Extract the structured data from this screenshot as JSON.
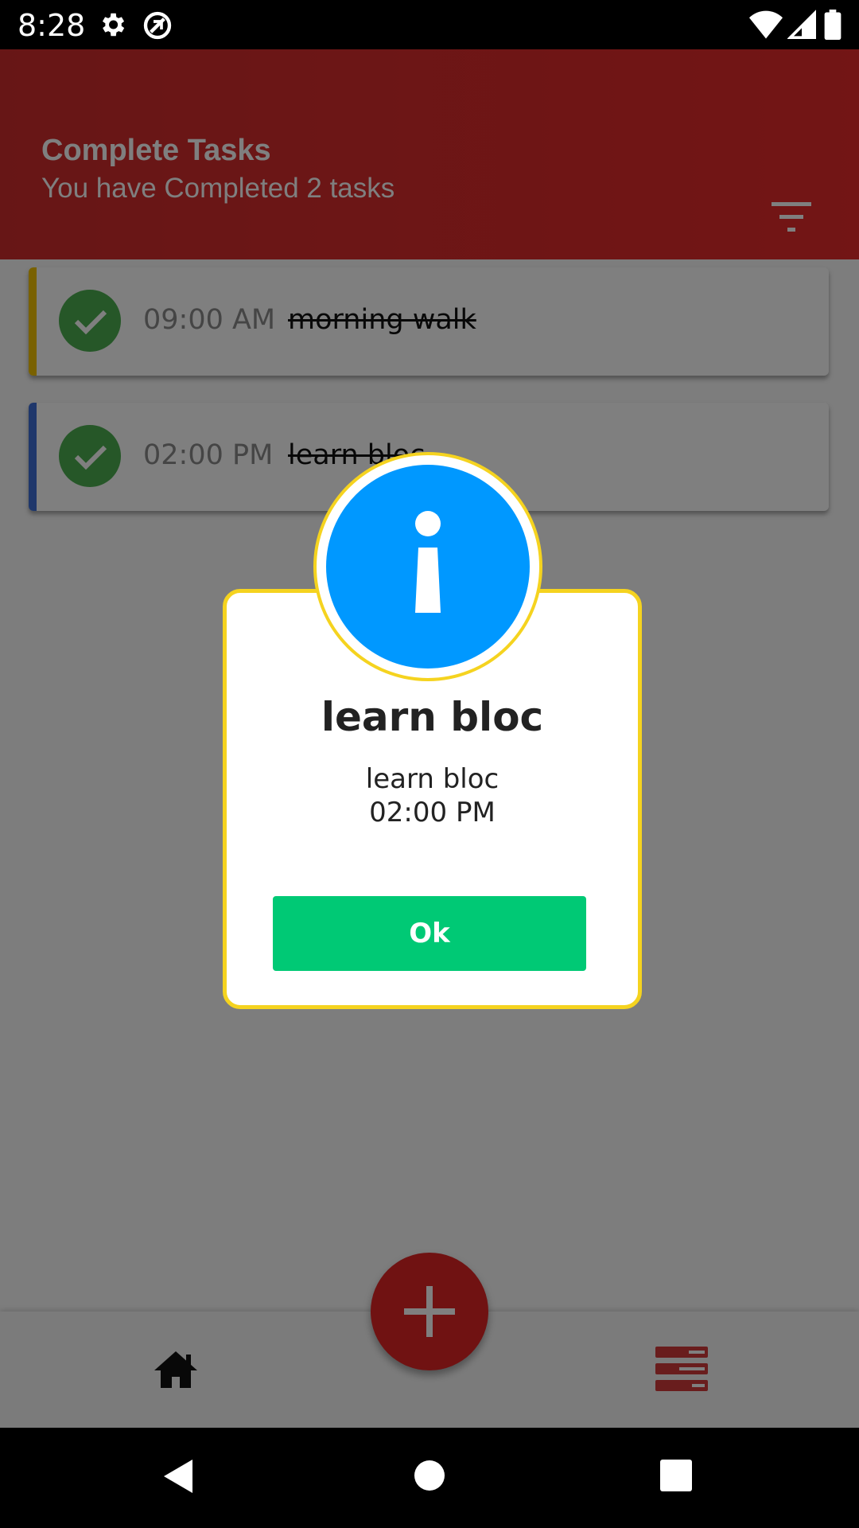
{
  "status_bar": {
    "time": "8:28",
    "icons": [
      "settings-icon",
      "sync-disabled-icon",
      "wifi-icon",
      "signal-icon",
      "battery-icon"
    ]
  },
  "header": {
    "title": "Complete Tasks",
    "subtitle": "You have Completed 2 tasks",
    "icon": "filter-icon",
    "color": "#e62a2a"
  },
  "tasks": [
    {
      "time": "09:00 AM",
      "title": "morning walk",
      "stripe_color": "#f2c200",
      "completed": true
    },
    {
      "time": "02:00 PM",
      "title": "learn bloc",
      "stripe_color": "#3f6fd6",
      "completed": true
    }
  ],
  "dialog": {
    "icon": "info-icon",
    "title": "learn bloc",
    "body_line1": "learn bloc",
    "body_line2": "02:00 PM",
    "ok_label": "Ok",
    "border_color": "#f5d31f",
    "badge_color": "#0098ff",
    "button_color": "#00c975"
  },
  "bottom_nav": {
    "items": [
      "home-icon",
      "list-icon"
    ],
    "fab_icon": "plus-icon",
    "fab_color": "#e02424"
  },
  "android_nav": [
    "back-icon",
    "home-circle-icon",
    "recents-icon"
  ]
}
